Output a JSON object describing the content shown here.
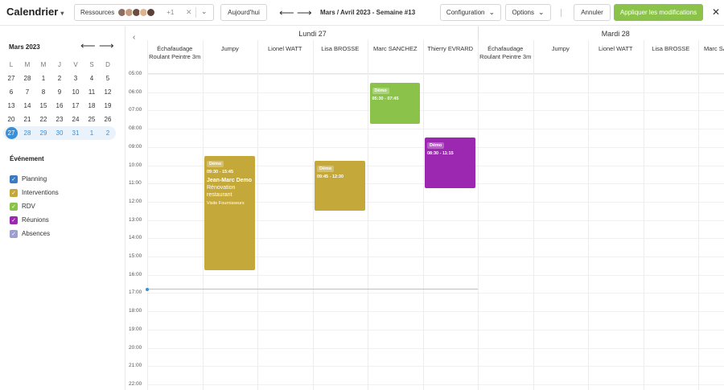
{
  "header": {
    "title": "Calendrier",
    "resources_label": "Ressources",
    "resources_more": "+1",
    "today": "Aujourd'hui",
    "period": "Mars / Avril 2023 - Semaine #13",
    "configuration": "Configuration",
    "options": "Options",
    "cancel": "Annuler",
    "apply": "Appliquer les modifications"
  },
  "colors": {
    "accent": "#3a8fd6",
    "apply": "#8bc34a",
    "planning": "#3a7cbf",
    "interventions": "#c5a83a",
    "rdv": "#8bc34a",
    "reunions": "#9c27b0",
    "absences": "#9e9ecf"
  },
  "mini_calendar": {
    "title": "Mars 2023",
    "weekdays": [
      "L",
      "M",
      "M",
      "J",
      "V",
      "S",
      "D"
    ],
    "weeks": [
      [
        "27",
        "28",
        "1",
        "2",
        "3",
        "4",
        "5"
      ],
      [
        "6",
        "7",
        "8",
        "9",
        "10",
        "11",
        "12"
      ],
      [
        "13",
        "14",
        "15",
        "16",
        "17",
        "18",
        "19"
      ],
      [
        "20",
        "21",
        "22",
        "23",
        "24",
        "25",
        "26"
      ],
      [
        "27",
        "28",
        "29",
        "30",
        "31",
        "1",
        "2"
      ]
    ],
    "current_week_index": 4,
    "selected_day": "27"
  },
  "events_legend": {
    "title": "Événement",
    "items": [
      {
        "label": "Planning",
        "color": "#3a7cbf"
      },
      {
        "label": "Interventions",
        "color": "#c5a83a"
      },
      {
        "label": "RDV",
        "color": "#8bc34a"
      },
      {
        "label": "Réunions",
        "color": "#9c27b0"
      },
      {
        "label": "Absences",
        "color": "#9e9ecf"
      }
    ]
  },
  "days": [
    {
      "label": "Lundi 27",
      "resources": [
        "Échafaudage Roulant Peintre 3m",
        "Jumpy",
        "Lionel WATT",
        "Lisa BROSSE",
        "Marc SANCHEZ",
        "Thierry EVRARD"
      ]
    },
    {
      "label": "Mardi 28",
      "resources": [
        "Échafaudage Roulant Peintre 3m",
        "Jumpy",
        "Lionel WATT",
        "Lisa BROSSE",
        "Marc SANCHEZ"
      ]
    }
  ],
  "hours": [
    "05:00",
    "06:00",
    "07:00",
    "08:00",
    "09:00",
    "10:00",
    "11:00",
    "12:00",
    "13:00",
    "14:00",
    "15:00",
    "16:00",
    "17:00",
    "18:00",
    "19:00",
    "20:00",
    "21:00",
    "22:00"
  ],
  "now_time": "16:46",
  "events": [
    {
      "day": 0,
      "resource": 1,
      "tag": "Démo",
      "time": "09:30 - 15:45",
      "start": "09:30",
      "end": "15:45",
      "name": "Jean-Marc Demo",
      "desc": "Rénovation restaurant",
      "sub": "Visite Fournisseurs",
      "color": "#c5a83a"
    },
    {
      "day": 0,
      "resource": 3,
      "tag": "Démo",
      "time": "09:45 - 12:30",
      "start": "09:45",
      "end": "12:30",
      "color": "#c5a83a"
    },
    {
      "day": 0,
      "resource": 4,
      "tag": "Démo",
      "time": "05:30 - 07:45",
      "start": "05:30",
      "end": "07:45",
      "color": "#8bc34a"
    },
    {
      "day": 0,
      "resource": 5,
      "tag": "Démo",
      "time": "08:30 - 11:15",
      "start": "08:30",
      "end": "11:15",
      "color": "#9c27b0"
    }
  ]
}
